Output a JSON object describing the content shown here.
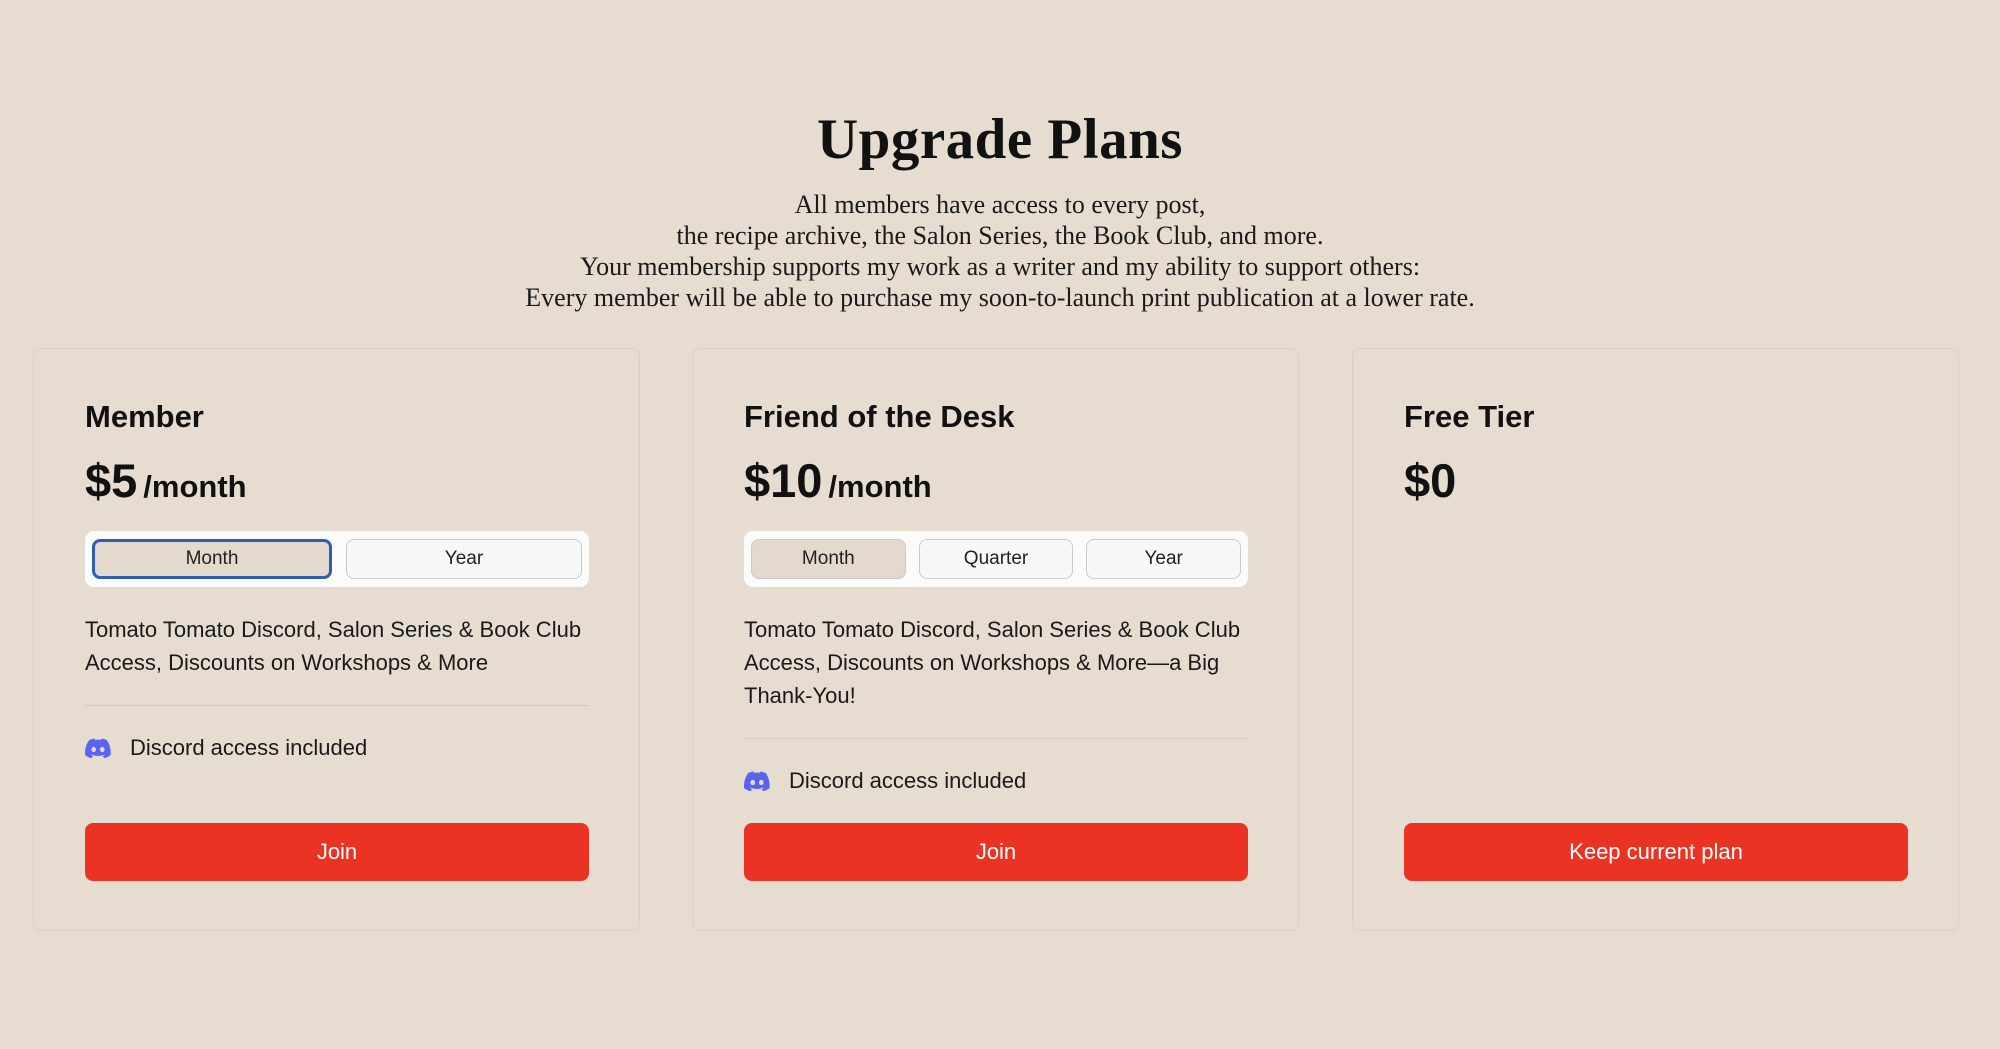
{
  "header": {
    "title": "Upgrade Plans",
    "subtitle_lines": [
      "All members have access to every post,",
      "the recipe archive, the Salon Series, the Book Club, and more.",
      "Your membership supports my work as a writer and my ability to support others:",
      "Every member will be able to purchase my soon-to-launch print publication at a lower rate."
    ]
  },
  "colors": {
    "background": "#e6dccf",
    "button": "#ea3323",
    "discord": "#5865f2",
    "focus_ring": "#2f5fb3"
  },
  "plans": [
    {
      "name": "Member",
      "price": "$5",
      "period": "/month",
      "billing_options": [
        "Month",
        "Year"
      ],
      "selected_option": "Month",
      "description": "Tomato Tomato Discord, Salon Series & Book Club Access, Discounts on Workshops & More",
      "feature": {
        "icon": "discord-icon",
        "label": "Discord access included"
      },
      "button_label": "Join"
    },
    {
      "name": "Friend of the Desk",
      "price": "$10",
      "period": "/month",
      "billing_options": [
        "Month",
        "Quarter",
        "Year"
      ],
      "selected_option": "Month",
      "description": "Tomato Tomato Discord, Salon Series & Book Club Access, Discounts on Workshops & More—a Big Thank-You!",
      "feature": {
        "icon": "discord-icon",
        "label": "Discord access included"
      },
      "button_label": "Join"
    },
    {
      "name": "Free Tier",
      "price": "$0",
      "button_label": "Keep current plan"
    }
  ]
}
